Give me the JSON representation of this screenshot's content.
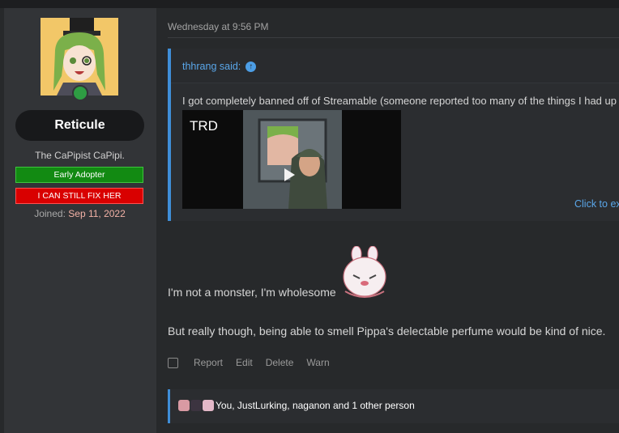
{
  "user": {
    "name": "Reticule",
    "title": "The CaPipist CaPipi.",
    "banners": [
      "Early Adopter",
      "I CAN STILL FIX HER"
    ],
    "joined_label": "Joined:",
    "joined_date": "Sep 11, 2022"
  },
  "post": {
    "timestamp": "Wednesday at 9:56 PM",
    "quote": {
      "author": "thhrang said:",
      "text": "I got completely banned off of Streamable (someone reported too many of the things I had up",
      "video_title": "TRD",
      "expand_label": "Click to ex"
    },
    "line1": "I'm not a monster, I'm wholesome",
    "line2": "But really though, being able to smell Pippa's delectable perfume would be kind of nice."
  },
  "actions": [
    "Report",
    "Edit",
    "Delete",
    "Warn"
  ],
  "reactions": {
    "text": "You, JustLurking, naganon and 1 other person"
  },
  "colors": {
    "accent": "#3f8ed8",
    "link": "#5aa7ea",
    "early_adopter": "#128a12",
    "fix_her": "#d90000"
  }
}
